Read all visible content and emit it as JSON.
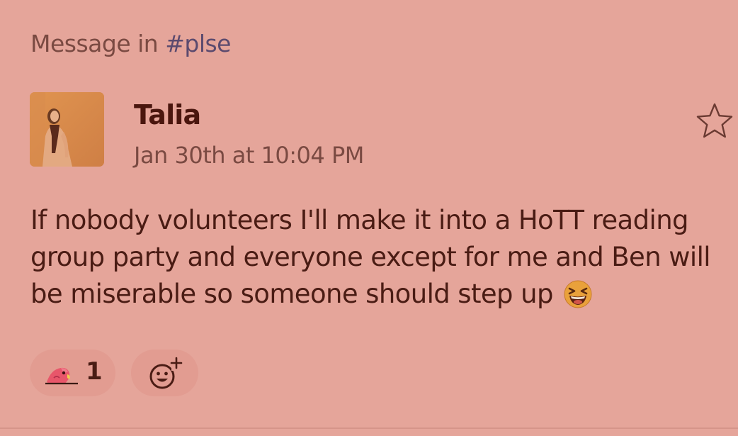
{
  "context": {
    "prefix": "Message in",
    "channel": "#plse"
  },
  "message": {
    "author": "Talia",
    "timestamp": "Jan 30th at 10:04 PM",
    "text_lines": [
      "If nobody volunteers I'll make it into a HoTT reading",
      "group party and everyone except for me and Ben will",
      "be miserable so someone should step up"
    ],
    "inline_emoji": "laughing-squint-emoji"
  },
  "reactions": [
    {
      "icon": "parrot-icon",
      "count": "1"
    }
  ],
  "icons": {
    "star": "star-icon",
    "add_reaction": "add-reaction-icon",
    "avatar": "avatar"
  },
  "colors": {
    "background": "#e5a59a",
    "text": "#4a1c14",
    "muted": "#7a4a42",
    "channel": "#5b4a6e",
    "reaction_bg": "#e29c91"
  }
}
